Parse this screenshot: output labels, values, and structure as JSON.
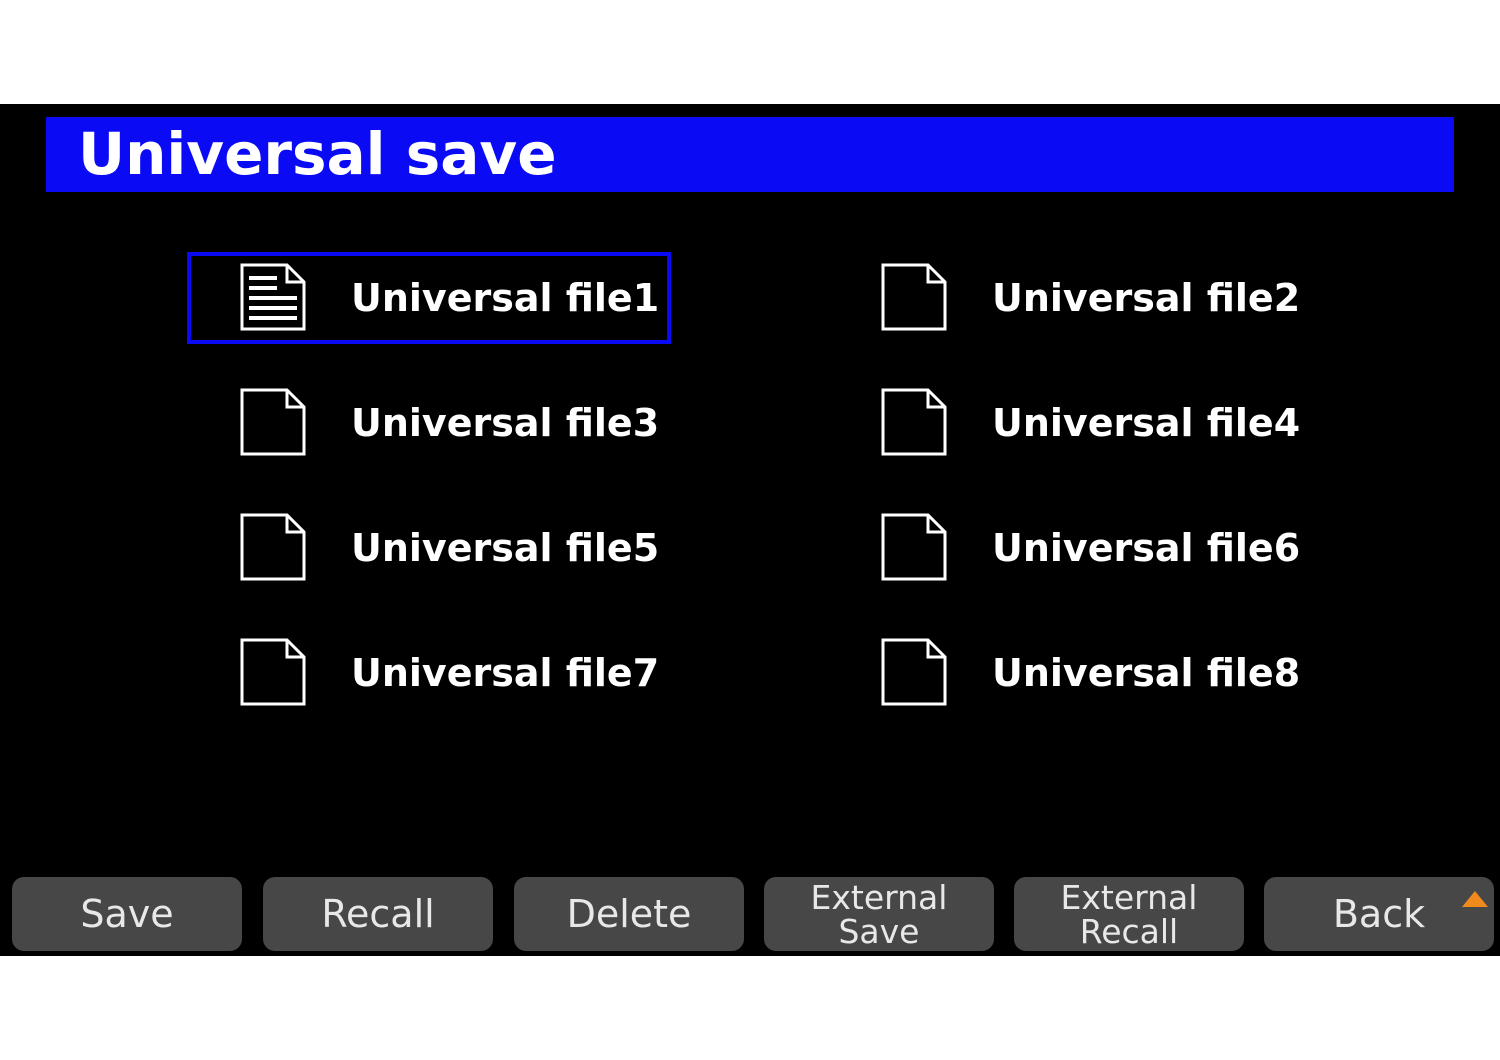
{
  "header": {
    "title": "Universal save"
  },
  "files": [
    {
      "label": "Universal file1",
      "icon": "document-filled-icon",
      "selected": true
    },
    {
      "label": "Universal file2",
      "icon": "document-empty-icon",
      "selected": false
    },
    {
      "label": "Universal file3",
      "icon": "document-empty-icon",
      "selected": false
    },
    {
      "label": "Universal file4",
      "icon": "document-empty-icon",
      "selected": false
    },
    {
      "label": "Universal file5",
      "icon": "document-empty-icon",
      "selected": false
    },
    {
      "label": "Universal file6",
      "icon": "document-empty-icon",
      "selected": false
    },
    {
      "label": "Universal file7",
      "icon": "document-empty-icon",
      "selected": false
    },
    {
      "label": "Universal file8",
      "icon": "document-empty-icon",
      "selected": false
    }
  ],
  "softkeys": {
    "save": "Save",
    "recall": "Recall",
    "delete": "Delete",
    "external_save": [
      "External",
      "Save"
    ],
    "external_recall": [
      "External",
      "Recall"
    ],
    "back": "Back"
  },
  "colors": {
    "title_bar": "#0a0af5",
    "selection_border": "#0a0af5",
    "softkey_bg": "#474747",
    "back_indicator": "#f08a1c",
    "screen_bg": "#000000"
  }
}
